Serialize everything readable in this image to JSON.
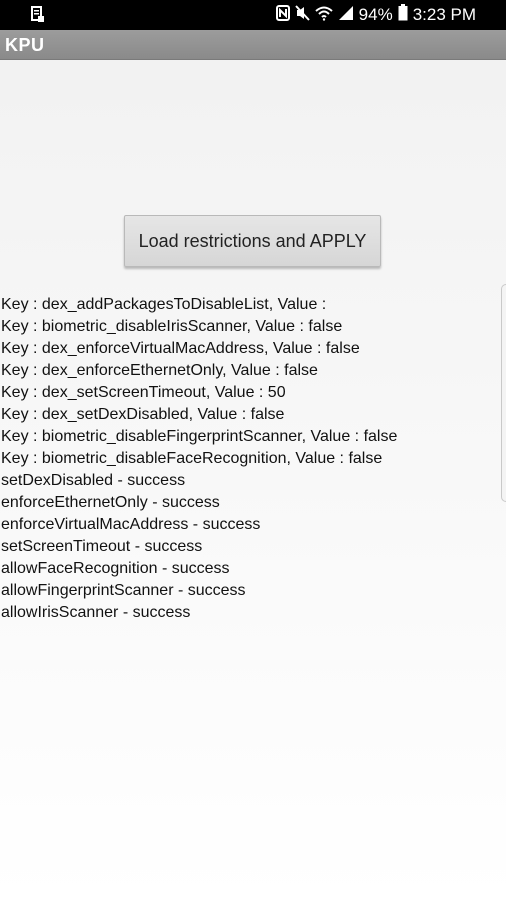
{
  "status_bar": {
    "icons": [
      "notification-icon",
      "nfc-icon",
      "mute-icon",
      "wifi-icon",
      "signal-icon",
      "battery-icon"
    ],
    "battery": "94%",
    "time": "3:23 PM"
  },
  "app_bar": {
    "title": "KPU"
  },
  "main": {
    "load_button_label": "Load restrictions and APPLY",
    "log_lines": [
      "Key : dex_addPackagesToDisableList, Value :",
      "Key : biometric_disableIrisScanner, Value : false",
      "Key : dex_enforceVirtualMacAddress, Value : false",
      "Key : dex_enforceEthernetOnly, Value : false",
      "Key : dex_setScreenTimeout, Value : 50",
      "Key : dex_setDexDisabled, Value : false",
      "Key : biometric_disableFingerprintScanner, Value : false",
      "Key : biometric_disableFaceRecognition, Value : false",
      "setDexDisabled - success",
      "enforceEthernetOnly - success",
      "enforceVirtualMacAddress - success",
      "setScreenTimeout - success",
      "allowFaceRecognition - success",
      "allowFingerprintScanner - success",
      "allowIrisScanner - success"
    ]
  },
  "colors": {
    "status_bar_bg": "#000000",
    "app_bar_bg": "#8f8f8f",
    "button_bg": "#dedede",
    "text": "#111111"
  }
}
